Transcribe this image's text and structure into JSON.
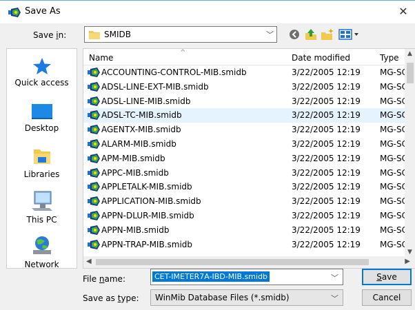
{
  "window": {
    "title": "Save As",
    "close_glyph": "✕"
  },
  "save_in": {
    "label_pre": "Save ",
    "label_mnemonic": "i",
    "label_post": "n:",
    "value": "SMIDB"
  },
  "toolbar": {
    "icons": [
      "back-icon",
      "up-folder-icon",
      "new-folder-icon",
      "view-menu-icon"
    ]
  },
  "places": [
    {
      "label": "Quick access",
      "icon": "star-icon"
    },
    {
      "label": "Desktop",
      "icon": "desktop-icon"
    },
    {
      "label": "Libraries",
      "icon": "libraries-icon"
    },
    {
      "label": "This PC",
      "icon": "computer-icon"
    },
    {
      "label": "Network",
      "icon": "network-icon"
    }
  ],
  "list": {
    "columns": {
      "name": "Name",
      "date": "Date modified",
      "type": "Type"
    },
    "selected_index": 3,
    "files": [
      {
        "name": "ACCOUNTING-CONTROL-MIB.smidb",
        "date": "3/22/2005 12:19",
        "type": "MG-SC"
      },
      {
        "name": "ADSL-LINE-EXT-MIB.smidb",
        "date": "3/22/2005 12:19",
        "type": "MG-SC"
      },
      {
        "name": "ADSL-LINE-MIB.smidb",
        "date": "3/22/2005 12:19",
        "type": "MG-SC"
      },
      {
        "name": "ADSL-TC-MIB.smidb",
        "date": "3/22/2005 12:19",
        "type": "MG-SC"
      },
      {
        "name": "AGENTX-MIB.smidb",
        "date": "3/22/2005 12:19",
        "type": "MG-SC"
      },
      {
        "name": "ALARM-MIB.smidb",
        "date": "3/22/2005 12:19",
        "type": "MG-SC"
      },
      {
        "name": "APM-MIB.smidb",
        "date": "3/22/2005 12:19",
        "type": "MG-SC"
      },
      {
        "name": "APPC-MIB.smidb",
        "date": "3/22/2005 12:19",
        "type": "MG-SC"
      },
      {
        "name": "APPLETALK-MIB.smidb",
        "date": "3/22/2005 12:19",
        "type": "MG-SC"
      },
      {
        "name": "APPLICATION-MIB.smidb",
        "date": "3/22/2005 12:19",
        "type": "MG-SC"
      },
      {
        "name": "APPN-DLUR-MIB.smidb",
        "date": "3/22/2005 12:19",
        "type": "MG-SC"
      },
      {
        "name": "APPN-MIB.smidb",
        "date": "3/22/2005 12:19",
        "type": "MG-SC"
      },
      {
        "name": "APPN-TRAP-MIB.smidb",
        "date": "3/22/2005 12:19",
        "type": "MG-SC"
      }
    ]
  },
  "file_name": {
    "label_pre": "File ",
    "label_mnemonic": "n",
    "label_post": "ame:",
    "value": "CET-IMETER7A-IBD-MIB.smidb"
  },
  "save_as_type": {
    "label_pre": "Save as ",
    "label_mnemonic": "t",
    "label_post": "ype:",
    "value": "WinMib Database Files (*.smidb)"
  },
  "buttons": {
    "save_mnemonic": "S",
    "save_rest": "ave",
    "cancel": "Cancel"
  }
}
